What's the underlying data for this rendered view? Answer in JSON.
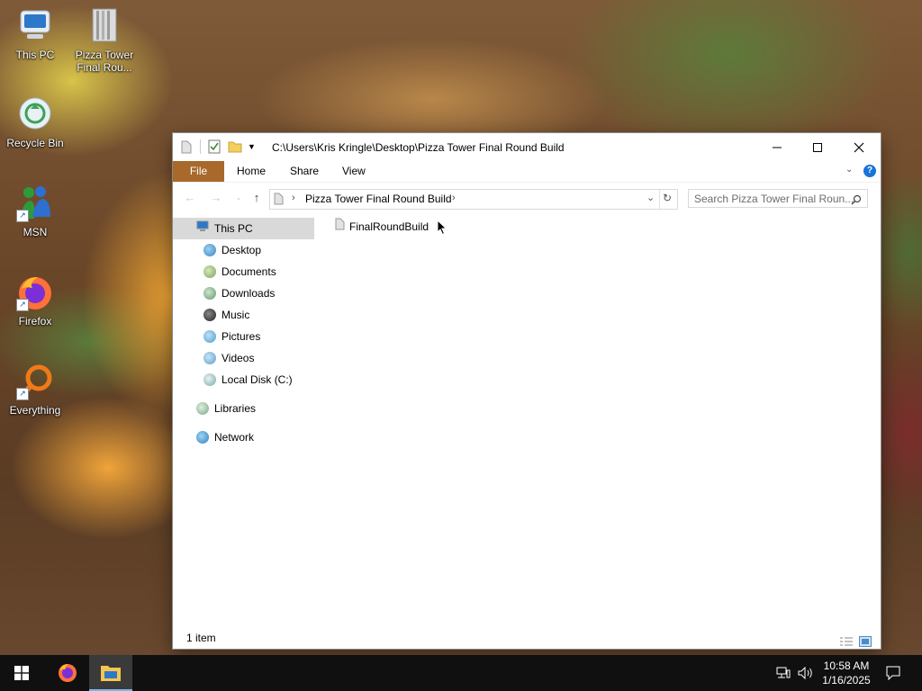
{
  "desktop": {
    "icons": [
      {
        "label": "This PC"
      },
      {
        "label": "Pizza Tower Final Rou..."
      },
      {
        "label": "Recycle Bin"
      },
      {
        "label": "MSN"
      },
      {
        "label": "Firefox"
      },
      {
        "label": "Everything"
      }
    ]
  },
  "window": {
    "title": "C:\\Users\\Kris Kringle\\Desktop\\Pizza Tower Final Round Build",
    "ribbon_tabs": [
      "File",
      "Home",
      "Share",
      "View"
    ],
    "address": {
      "crumb": "Pizza Tower Final Round Build",
      "separator": "›"
    },
    "search": {
      "placeholder": "Search Pizza Tower Final Roun..."
    },
    "nav_pane": {
      "this_pc": "This PC",
      "items": [
        "Desktop",
        "Documents",
        "Downloads",
        "Music",
        "Pictures",
        "Videos",
        "Local Disk (C:)"
      ],
      "libraries": "Libraries",
      "network": "Network"
    },
    "files": [
      {
        "name": "FinalRoundBuild",
        "type": "folder"
      }
    ],
    "status": "1 item"
  },
  "taskbar": {
    "time": "10:58 AM",
    "date": "1/16/2025"
  },
  "colors": {
    "file_tab": "#a8692b",
    "taskbar": "#101010",
    "selection": "#d9d9d9",
    "help": "#1a73d9"
  }
}
